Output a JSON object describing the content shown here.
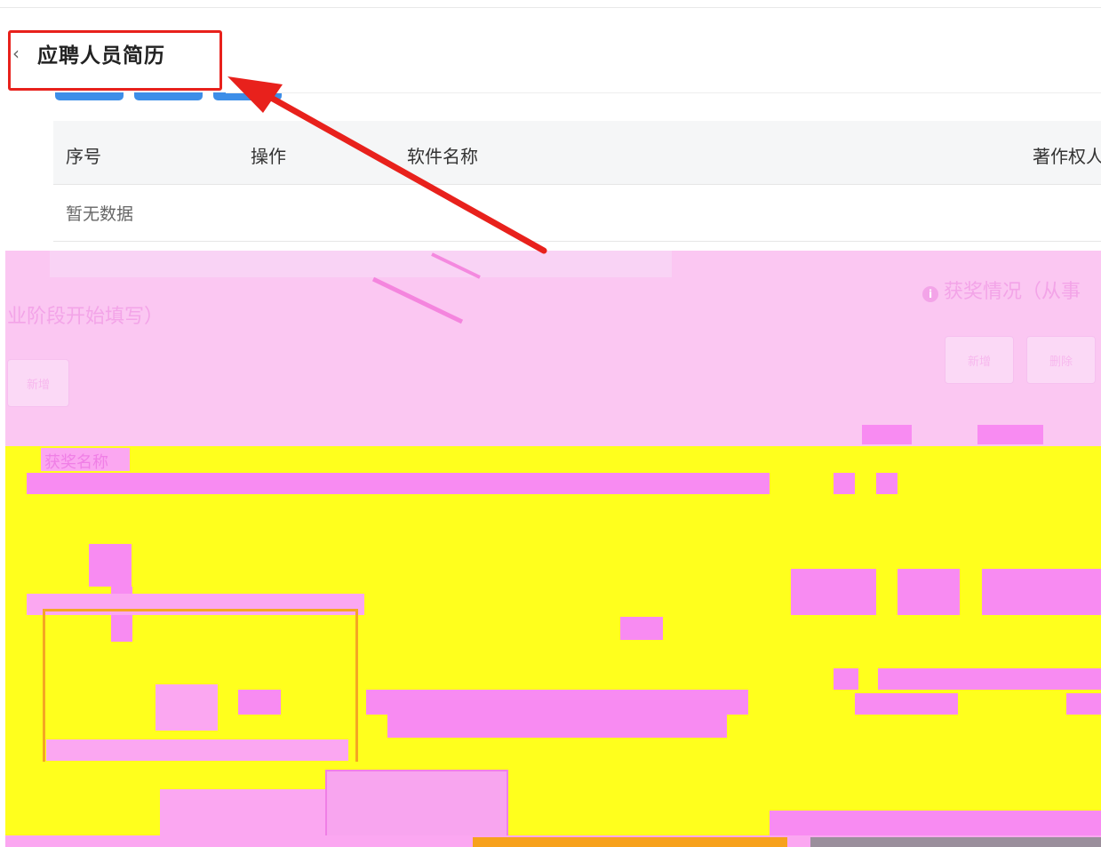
{
  "header": {
    "back_icon": "‹",
    "title": "应聘人员简历"
  },
  "table": {
    "columns": [
      "序号",
      "操作",
      "软件名称",
      "著作权人"
    ],
    "empty_text": "暂无数据"
  },
  "glitched_section": {
    "section_title": "获奖情况（从事",
    "section_title_left": "业阶段开始填写）",
    "add_button": "新增",
    "delete_button": "删除",
    "left_button": "新增",
    "field_label": "获奖名称"
  },
  "annotation": {
    "highlight_color": "#e8211c",
    "arrow_color": "#e8211c"
  }
}
